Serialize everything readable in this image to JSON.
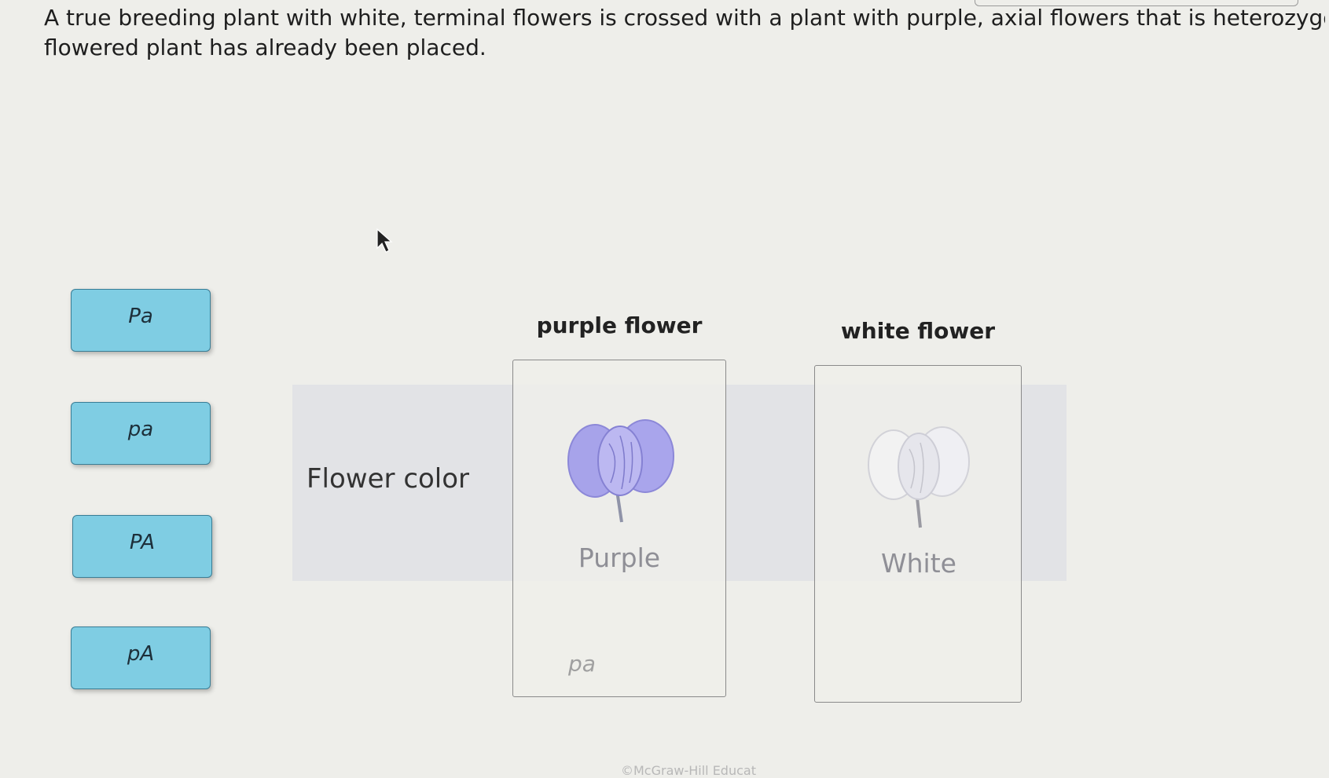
{
  "question": {
    "line1": "A true breeding plant with white, terminal flowers is crossed with a plant with purple, axial flowers that is heterozygou",
    "line2": "flowered plant has already been placed."
  },
  "alleles": [
    {
      "label": "Pa"
    },
    {
      "label": "pa"
    },
    {
      "label": "PA"
    },
    {
      "label": "pA"
    }
  ],
  "table": {
    "row_label": "Flower color",
    "columns": [
      {
        "header": "purple flower",
        "phenotype": "Purple",
        "placed": "pa",
        "icon": "purple-flower-icon"
      },
      {
        "header": "white flower",
        "phenotype": "White",
        "placed": "",
        "icon": "white-flower-icon"
      }
    ]
  },
  "colors": {
    "allele_tile": "#7fcde3",
    "allele_border": "#3a7d95",
    "purple_flower": "#9e9be6",
    "background": "#eeeeea"
  },
  "footer": "©McGraw-Hill Educat"
}
